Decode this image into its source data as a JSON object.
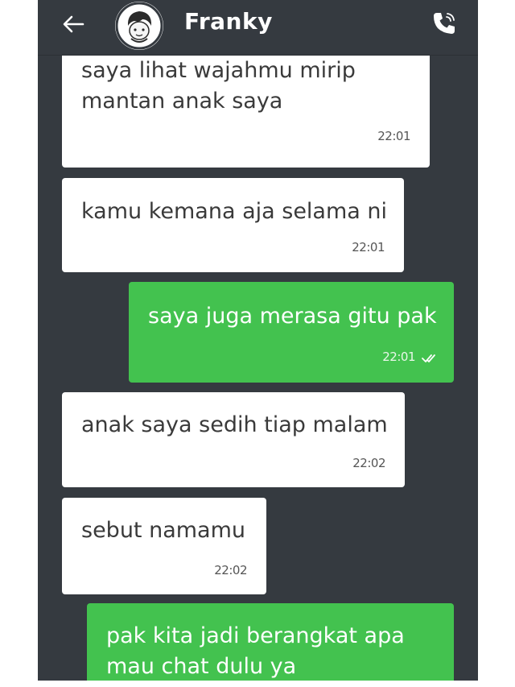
{
  "header": {
    "contact_name": "Franky"
  },
  "messages": [
    {
      "direction": "in",
      "text": "saya lihat wajahmu mirip\nmantan anak saya",
      "time": "22:01"
    },
    {
      "direction": "in",
      "text": "kamu kemana aja selama ni",
      "time": "22:01"
    },
    {
      "direction": "out",
      "text": "saya juga merasa gitu pak",
      "time": "22:01",
      "status": "read"
    },
    {
      "direction": "in",
      "text": "anak saya sedih tiap malam",
      "time": "22:02"
    },
    {
      "direction": "in",
      "text": "sebut namamu",
      "time": "22:02"
    },
    {
      "direction": "out",
      "text": "pak kita jadi berangkat apa\nmau chat dulu ya",
      "time": "",
      "status": ""
    }
  ],
  "colors": {
    "background": "#353a40",
    "incoming_bubble": "#ffffff",
    "outgoing_bubble": "#43c24f"
  },
  "icons": {
    "back": "back-arrow-icon",
    "avatar": "avatar",
    "call": "phone-call-icon",
    "read_receipt": "double-check-icon"
  }
}
